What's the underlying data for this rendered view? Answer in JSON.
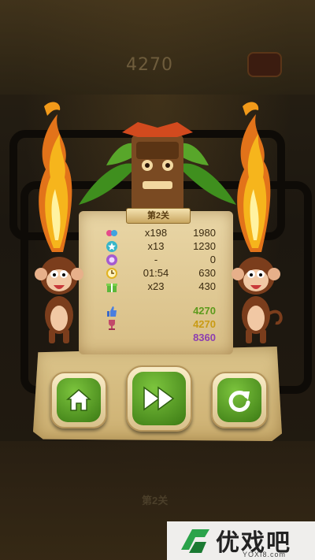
{
  "background": {
    "score_display": "4270",
    "level_label": "第2关"
  },
  "result": {
    "level_banner": "第2关",
    "rows": [
      {
        "icon": "ball-chain-icon",
        "count": "x198",
        "points": "1980"
      },
      {
        "icon": "star-bubble-icon",
        "count": "x13",
        "points": "1230"
      },
      {
        "icon": "combo-bubble-icon",
        "count": "-",
        "points": "0"
      },
      {
        "icon": "clock-icon",
        "count": "01:54",
        "points": "630"
      },
      {
        "icon": "gift-icon",
        "count": "x23",
        "points": "430"
      }
    ],
    "totals": [
      {
        "icon": "thumbs-up-icon",
        "value": "4270",
        "color": "#5d9a1c"
      },
      {
        "icon": "trophy-icon",
        "value": "4270",
        "color": "#c99b14"
      },
      {
        "icon": "",
        "value": "8360",
        "color": "#8d3fb0"
      }
    ]
  },
  "buttons": {
    "home": "home-icon",
    "next": "fast-forward-icon",
    "retry": "retry-icon"
  },
  "watermark": {
    "brand": "优戏吧",
    "url": "YOXI8.com"
  }
}
